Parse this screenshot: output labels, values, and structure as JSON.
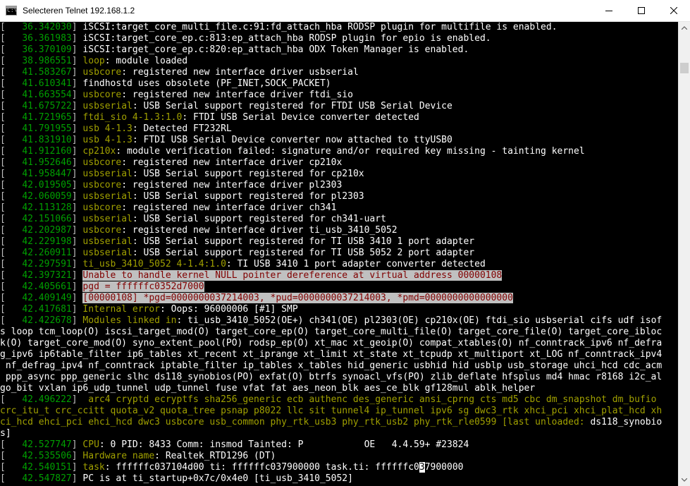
{
  "window": {
    "title": "Selecteren Telnet 192.168.1.2",
    "icon_name": "console-app-icon",
    "icon_glyph": "C:\\",
    "buttons": {
      "minimize": "minimize",
      "maximize": "maximize",
      "close": "close"
    }
  },
  "colors": {
    "timestamp": "#00a000",
    "tag": "#a0a000",
    "plain": "#c0c0c0",
    "highlight_bg": "#c0c0c0",
    "highlight_fg": "#800000",
    "bright": "#ffffff"
  },
  "console": {
    "lines": [
      [
        {
          "t": "[   ",
          "c": "pl"
        },
        {
          "t": "36.342030",
          "c": "ts"
        },
        {
          "t": "] ",
          "c": "pl"
        },
        {
          "t": "iSCSI:target_core_multi_file.c:91:fd_attach_hba RODSP plugin for multifile is enabled.",
          "c": "wp"
        }
      ],
      [
        {
          "t": "[   ",
          "c": "pl"
        },
        {
          "t": "36.361983",
          "c": "ts"
        },
        {
          "t": "] ",
          "c": "pl"
        },
        {
          "t": "iSCSI:target_core_ep.c:813:ep_attach_hba RODSP plugin for epio is enabled.",
          "c": "wp"
        }
      ],
      [
        {
          "t": "[   ",
          "c": "pl"
        },
        {
          "t": "36.370109",
          "c": "ts"
        },
        {
          "t": "] ",
          "c": "pl"
        },
        {
          "t": "iSCSI:target_core_ep.c:820:ep_attach_hba ODX Token Manager is enabled.",
          "c": "wp"
        }
      ],
      [
        {
          "t": "[   ",
          "c": "pl"
        },
        {
          "t": "38.986551",
          "c": "ts"
        },
        {
          "t": "] ",
          "c": "pl"
        },
        {
          "t": "loop",
          "c": "tag"
        },
        {
          "t": ": module loaded",
          "c": "wp"
        }
      ],
      [
        {
          "t": "[   ",
          "c": "pl"
        },
        {
          "t": "41.583267",
          "c": "ts"
        },
        {
          "t": "] ",
          "c": "pl"
        },
        {
          "t": "usbcore",
          "c": "tag"
        },
        {
          "t": ": registered new interface driver usbserial",
          "c": "wp"
        }
      ],
      [
        {
          "t": "[   ",
          "c": "pl"
        },
        {
          "t": "41.610341",
          "c": "ts"
        },
        {
          "t": "] ",
          "c": "pl"
        },
        {
          "t": "findhostd uses obsolete (PF_INET,SOCK_PACKET)",
          "c": "wp"
        }
      ],
      [
        {
          "t": "[   ",
          "c": "pl"
        },
        {
          "t": "41.663554",
          "c": "ts"
        },
        {
          "t": "] ",
          "c": "pl"
        },
        {
          "t": "usbcore",
          "c": "tag"
        },
        {
          "t": ": registered new interface driver ftdi_sio",
          "c": "wp"
        }
      ],
      [
        {
          "t": "[   ",
          "c": "pl"
        },
        {
          "t": "41.675722",
          "c": "ts"
        },
        {
          "t": "] ",
          "c": "pl"
        },
        {
          "t": "usbserial",
          "c": "tag"
        },
        {
          "t": ": USB Serial support registered for FTDI USB Serial Device",
          "c": "wp"
        }
      ],
      [
        {
          "t": "[   ",
          "c": "pl"
        },
        {
          "t": "41.721965",
          "c": "ts"
        },
        {
          "t": "] ",
          "c": "pl"
        },
        {
          "t": "ftdi_sio 4-1.3:1.0",
          "c": "tag"
        },
        {
          "t": ": FTDI USB Serial Device converter detected",
          "c": "wp"
        }
      ],
      [
        {
          "t": "[   ",
          "c": "pl"
        },
        {
          "t": "41.791955",
          "c": "ts"
        },
        {
          "t": "] ",
          "c": "pl"
        },
        {
          "t": "usb 4-1.3",
          "c": "tag"
        },
        {
          "t": ": Detected FT232RL",
          "c": "wp"
        }
      ],
      [
        {
          "t": "[   ",
          "c": "pl"
        },
        {
          "t": "41.831910",
          "c": "ts"
        },
        {
          "t": "] ",
          "c": "pl"
        },
        {
          "t": "usb 4-1.3",
          "c": "tag"
        },
        {
          "t": ": FTDI USB Serial Device converter now attached to ttyUSB0",
          "c": "wp"
        }
      ],
      [
        {
          "t": "[   ",
          "c": "pl"
        },
        {
          "t": "41.912160",
          "c": "ts"
        },
        {
          "t": "] ",
          "c": "pl"
        },
        {
          "t": "cp210x",
          "c": "tag"
        },
        {
          "t": ": module verification failed: signature and/or required key missing - tainting kernel",
          "c": "wp"
        }
      ],
      [
        {
          "t": "[   ",
          "c": "pl"
        },
        {
          "t": "41.952646",
          "c": "ts"
        },
        {
          "t": "] ",
          "c": "pl"
        },
        {
          "t": "usbcore",
          "c": "tag"
        },
        {
          "t": ": registered new interface driver cp210x",
          "c": "wp"
        }
      ],
      [
        {
          "t": "[   ",
          "c": "pl"
        },
        {
          "t": "41.958447",
          "c": "ts"
        },
        {
          "t": "] ",
          "c": "pl"
        },
        {
          "t": "usbserial",
          "c": "tag"
        },
        {
          "t": ": USB Serial support registered for cp210x",
          "c": "wp"
        }
      ],
      [
        {
          "t": "[   ",
          "c": "pl"
        },
        {
          "t": "42.019505",
          "c": "ts"
        },
        {
          "t": "] ",
          "c": "pl"
        },
        {
          "t": "usbcore",
          "c": "tag"
        },
        {
          "t": ": registered new interface driver pl2303",
          "c": "wp"
        }
      ],
      [
        {
          "t": "[   ",
          "c": "pl"
        },
        {
          "t": "42.060059",
          "c": "ts"
        },
        {
          "t": "] ",
          "c": "pl"
        },
        {
          "t": "usbserial",
          "c": "tag"
        },
        {
          "t": ": USB Serial support registered for pl2303",
          "c": "wp"
        }
      ],
      [
        {
          "t": "[   ",
          "c": "pl"
        },
        {
          "t": "42.113128",
          "c": "ts"
        },
        {
          "t": "] ",
          "c": "pl"
        },
        {
          "t": "usbcore",
          "c": "tag"
        },
        {
          "t": ": registered new interface driver ch341",
          "c": "wp"
        }
      ],
      [
        {
          "t": "[   ",
          "c": "pl"
        },
        {
          "t": "42.151066",
          "c": "ts"
        },
        {
          "t": "] ",
          "c": "pl"
        },
        {
          "t": "usbserial",
          "c": "tag"
        },
        {
          "t": ": USB Serial support registered for ch341-uart",
          "c": "wp"
        }
      ],
      [
        {
          "t": "[   ",
          "c": "pl"
        },
        {
          "t": "42.202987",
          "c": "ts"
        },
        {
          "t": "] ",
          "c": "pl"
        },
        {
          "t": "usbcore",
          "c": "tag"
        },
        {
          "t": ": registered new interface driver ti_usb_3410_5052",
          "c": "wp"
        }
      ],
      [
        {
          "t": "[   ",
          "c": "pl"
        },
        {
          "t": "42.229198",
          "c": "ts"
        },
        {
          "t": "] ",
          "c": "pl"
        },
        {
          "t": "usbserial",
          "c": "tag"
        },
        {
          "t": ": USB Serial support registered for TI USB 3410 1 port adapter",
          "c": "wp"
        }
      ],
      [
        {
          "t": "[   ",
          "c": "pl"
        },
        {
          "t": "42.260911",
          "c": "ts"
        },
        {
          "t": "] ",
          "c": "pl"
        },
        {
          "t": "usbserial",
          "c": "tag"
        },
        {
          "t": ": USB Serial support registered for TI USB 5052 2 port adapter",
          "c": "wp"
        }
      ],
      [
        {
          "t": "[   ",
          "c": "pl"
        },
        {
          "t": "42.297591",
          "c": "ts"
        },
        {
          "t": "] ",
          "c": "pl"
        },
        {
          "t": "ti_usb_3410_5052 4-1.4:1.0",
          "c": "tag"
        },
        {
          "t": ": TI USB 3410 1 port adapter converter detected",
          "c": "wp"
        }
      ],
      [
        {
          "t": "[   ",
          "c": "pl"
        },
        {
          "t": "42.397321",
          "c": "ts"
        },
        {
          "t": "] ",
          "c": "pl"
        },
        {
          "t": "Unable to handle kernel NULL pointer dereference at virtual address 00000108",
          "c": "hl"
        }
      ],
      [
        {
          "t": "[   ",
          "c": "pl"
        },
        {
          "t": "42.405661",
          "c": "ts"
        },
        {
          "t": "] ",
          "c": "pl"
        },
        {
          "t": "pgd = ffffffc0352d7000",
          "c": "hl"
        }
      ],
      [
        {
          "t": "[   ",
          "c": "pl"
        },
        {
          "t": "42.409149",
          "c": "ts"
        },
        {
          "t": "] ",
          "c": "pl"
        },
        {
          "t": "[00000108] *pgd=0000000037214003, *pud=0000000037214003, *pmd=0000000000000000",
          "c": "hl"
        }
      ],
      [
        {
          "t": "[   ",
          "c": "pl"
        },
        {
          "t": "42.417681",
          "c": "ts"
        },
        {
          "t": "] ",
          "c": "pl"
        },
        {
          "t": "Internal error",
          "c": "tag"
        },
        {
          "t": ": Oops: 96000006 [#1] SMP",
          "c": "wp"
        }
      ],
      [
        {
          "t": "[   ",
          "c": "pl"
        },
        {
          "t": "42.422678",
          "c": "ts"
        },
        {
          "t": "] ",
          "c": "pl"
        },
        {
          "t": "Modules linked in",
          "c": "tag"
        },
        {
          "t": ": ti_usb_3410_5052(OE+) ch341(OE) pl2303(OE) cp210x(OE) ftdi_sio usbserial cifs udf isof",
          "c": "wp"
        }
      ],
      [
        {
          "t": "s loop tcm_loop(O) iscsi_target_mod(O) target_core_ep(O) target_core_multi_file(O) target_core_file(O) target_core_ibloc",
          "c": "wp"
        }
      ],
      [
        {
          "t": "k(O) target_core_mod(O) syno_extent_pool(PO) rodsp_ep(O) xt_mac xt_geoip(O) compat_xtables(O) nf_conntrack_ipv6 nf_defra",
          "c": "wp"
        }
      ],
      [
        {
          "t": "g_ipv6 ip6table_filter ip6_tables xt_recent xt_iprange xt_limit xt_state xt_tcpudp xt_multiport xt_LOG nf_conntrack_ipv4",
          "c": "wp"
        }
      ],
      [
        {
          "t": " nf_defrag_ipv4 nf_conntrack iptable_filter ip_tables x_tables hid_generic usbhid hid usblp usb_storage uhci_hcd cdc_acm",
          "c": "wp"
        }
      ],
      [
        {
          "t": " ppp_async ppp_generic slhc ds118_synobios(PO) exfat(O) btrfs synoacl_vfs(PO) zlib_deflate hfsplus md4 hmac r8168 i2c_al",
          "c": "wp"
        }
      ],
      [
        {
          "t": "go_bit vxlan ip6_udp_tunnel udp_tunnel fuse vfat fat aes_neon_blk aes_ce_blk gf128mul ablk_helper",
          "c": "wp"
        }
      ],
      [
        {
          "t": "[   ",
          "c": "pl"
        },
        {
          "t": "42.496222",
          "c": "ts"
        },
        {
          "t": "] ",
          "c": "pl"
        },
        {
          "t": " arc4 cryptd ecryptfs sha256_generic ecb authenc des_generic ansi_cprng cts md5 cbc dm_snapshot dm_bufio",
          "c": "dy"
        }
      ],
      [
        {
          "t": "crc_itu_t crc_ccitt quota_v2 quota_tree psnap p8022 llc sit tunnel4 ip_tunnel ipv6 sg dwc3_rtk xhci_pci xhci_plat_hcd xh",
          "c": "dy"
        }
      ],
      [
        {
          "t": "ci_hcd ehci_pci ehci_hcd dwc3 usbcore usb_common phy_rtk_usb3 phy_rtk_usb2 phy_rtk_rle0599 [last unloaded: ",
          "c": "dy"
        },
        {
          "t": "ds118_synobio",
          "c": "wp"
        }
      ],
      [
        {
          "t": "s]",
          "c": "wp"
        }
      ],
      [
        {
          "t": "[   ",
          "c": "pl"
        },
        {
          "t": "42.527747",
          "c": "ts"
        },
        {
          "t": "] ",
          "c": "pl"
        },
        {
          "t": "CPU",
          "c": "tag"
        },
        {
          "t": ": 0 PID: 8433 Comm: insmod Tainted: P           OE   4.4.59+ #23824",
          "c": "wp"
        }
      ],
      [
        {
          "t": "[   ",
          "c": "pl"
        },
        {
          "t": "42.535506",
          "c": "ts"
        },
        {
          "t": "] ",
          "c": "pl"
        },
        {
          "t": "Hardware name",
          "c": "tag"
        },
        {
          "t": ": Realtek_RTD1296 (DT)",
          "c": "wp"
        }
      ],
      [
        {
          "t": "[   ",
          "c": "pl"
        },
        {
          "t": "42.540151",
          "c": "ts"
        },
        {
          "t": "] ",
          "c": "pl"
        },
        {
          "t": "task",
          "c": "tag"
        },
        {
          "t": ": ffffffc037104d00 ti: ffffffc037900000 task.ti: ffffffc0",
          "c": "wp"
        },
        {
          "t": "3",
          "c": "caret"
        },
        {
          "t": "7900000",
          "c": "wp"
        }
      ],
      [
        {
          "t": "[   ",
          "c": "pl"
        },
        {
          "t": "42.547827",
          "c": "ts"
        },
        {
          "t": "] ",
          "c": "pl"
        },
        {
          "t": "PC is at ti_startup+0x7c/0x4e0 [ti_usb_3410_5052]",
          "c": "wp"
        }
      ]
    ]
  }
}
